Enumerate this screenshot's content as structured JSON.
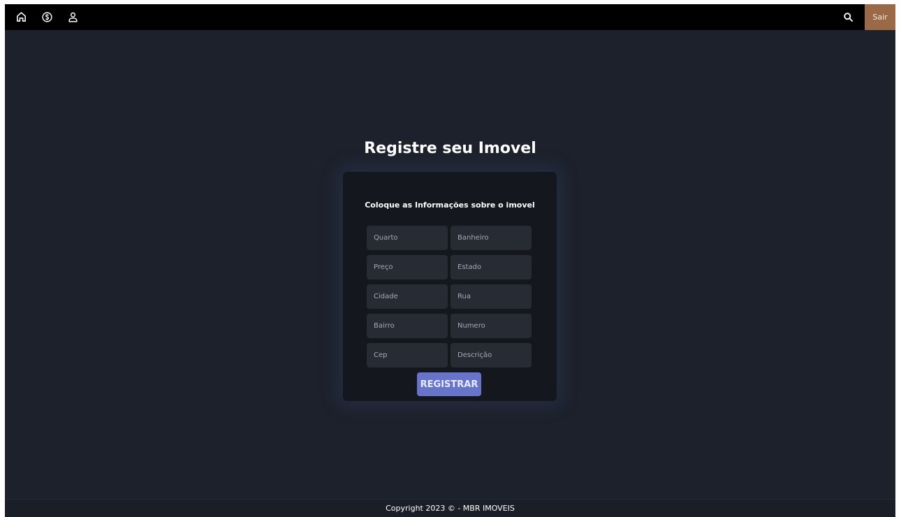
{
  "nav": {
    "icons": [
      "home-icon",
      "dollar-icon",
      "user-icon"
    ],
    "search_icon": "search-icon",
    "logout_label": "Sair",
    "logout_color": "#9a6a48"
  },
  "page": {
    "title": "Registre seu Imovel"
  },
  "form": {
    "subtitle": "Coloque as Informações sobre o imovel",
    "fields": {
      "quarto": "Quarto",
      "banheiro": "Banheiro",
      "preco": "Preço",
      "estado": "Estado",
      "cidade": "Cidade",
      "rua": "Rua",
      "bairro": "Bairro",
      "numero": "Numero",
      "cep": "Cep",
      "descricao": "Descrição"
    },
    "submit_label": "REGISTRAR",
    "submit_color": "#6774c9"
  },
  "footer": {
    "text": "Copyright 2023 © - MBR IMOVEIS"
  }
}
